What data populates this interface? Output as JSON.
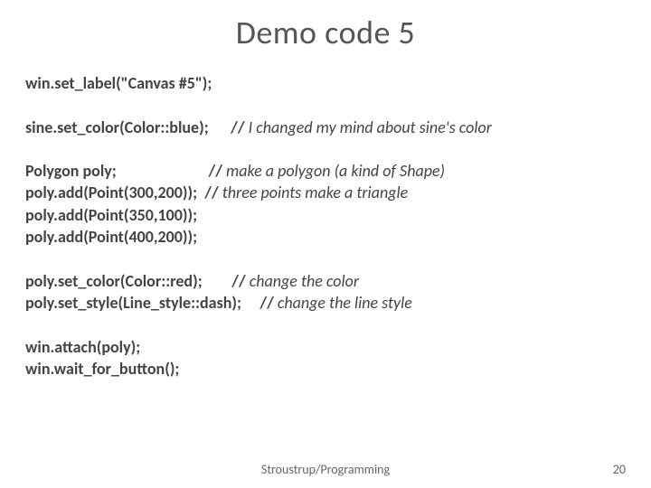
{
  "title": "Demo code 5",
  "lines": {
    "l1_code": "win.set_label(\"Canvas #5\");",
    "l2_code": "sine.set_color(Color::blue);",
    "l2_comment": " I changed my mind about sine's color",
    "l3_code": "Polygon poly;",
    "l3_comment": " make a polygon (a kind of Shape)",
    "l4_code": "poly.add(Point(300,200));",
    "l4_comment": " three points make a triangle",
    "l5_code": "poly.add(Point(350,100));",
    "l6_code": "poly.add(Point(400,200));",
    "l7_code": "poly.set_color(Color::red);",
    "l7_comment": " change the color",
    "l8_code": "poly.set_style(Line_style::dash);",
    "l8_comment": " change the line style",
    "l9_code": "win.attach(poly);",
    "l10_code": "win.wait_for_button();"
  },
  "slashes": "//",
  "footer_center": "Stroustrup/Programming",
  "page_number": "20"
}
